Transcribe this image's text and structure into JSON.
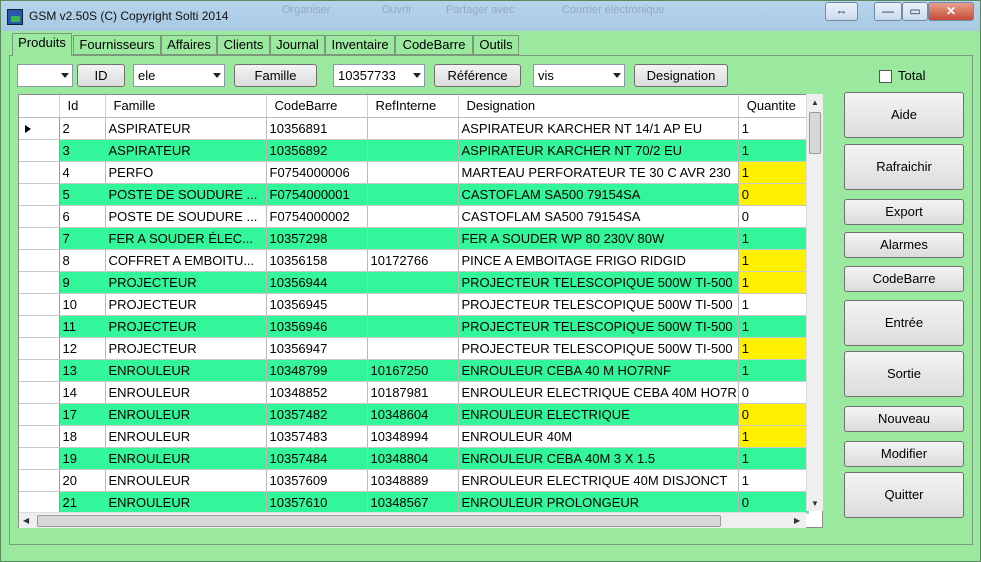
{
  "window": {
    "title": "GSM v2.50S (C) Copyright Solti 2014",
    "controls": {
      "restore": "⇔",
      "minimize": "—",
      "maximize": "▭",
      "close": "✕"
    },
    "ghost_menu": [
      "Organiser",
      "Ouvrir",
      "Partager avec",
      "Courrier électronique"
    ]
  },
  "tabs": [
    {
      "label": "Produits",
      "active": true
    },
    {
      "label": "Fournisseurs"
    },
    {
      "label": "Affaires"
    },
    {
      "label": "Clients"
    },
    {
      "label": "Journal"
    },
    {
      "label": "Inventaire"
    },
    {
      "label": "CodeBarre"
    },
    {
      "label": "Outils"
    }
  ],
  "filters": {
    "id_combo": "",
    "id_button": "ID",
    "famille_combo": "ele",
    "famille_button": "Famille",
    "reference_combo": "10357733",
    "reference_button": "Référence",
    "designation_combo": "vis",
    "designation_button": "Designation"
  },
  "total": {
    "label": "Total",
    "checked": false
  },
  "grid": {
    "columns": [
      "Id",
      "Famille",
      "CodeBarre",
      "RefInterne",
      "Designation",
      "Quantite"
    ],
    "rows": [
      {
        "id": "2",
        "famille": "ASPIRATEUR",
        "codebarre": "10356891",
        "refinterne": "",
        "designation": "ASPIRATEUR KARCHER NT 14/1 AP EU",
        "quantite": "1",
        "green": false,
        "yellow": false,
        "selected": true
      },
      {
        "id": "3",
        "famille": "ASPIRATEUR",
        "codebarre": "10356892",
        "refinterne": "",
        "designation": "ASPIRATEUR KARCHER NT 70/2 EU",
        "quantite": "1",
        "green": true,
        "yellow": false
      },
      {
        "id": "4",
        "famille": "PERFO",
        "codebarre": "F0754000006",
        "refinterne": "",
        "designation": "MARTEAU PERFORATEUR TE 30 C AVR 230",
        "quantite": "1",
        "green": false,
        "yellow": true
      },
      {
        "id": "5",
        "famille": "POSTE DE SOUDURE ...",
        "codebarre": "F0754000001",
        "refinterne": "",
        "designation": "CASTOFLAM SA500 79154SA",
        "quantite": "0",
        "green": true,
        "yellow": true
      },
      {
        "id": "6",
        "famille": "POSTE DE SOUDURE ...",
        "codebarre": "F0754000002",
        "refinterne": "",
        "designation": "CASTOFLAM SA500 79154SA",
        "quantite": "0",
        "green": false,
        "yellow": false
      },
      {
        "id": "7",
        "famille": "FER A SOUDER ÉLEC...",
        "codebarre": "10357298",
        "refinterne": "",
        "designation": "FER A SOUDER WP 80 230V 80W",
        "quantite": "1",
        "green": true,
        "yellow": false
      },
      {
        "id": "8",
        "famille": "COFFRET A EMBOITU...",
        "codebarre": "10356158",
        "refinterne": "10172766",
        "designation": "PINCE A EMBOITAGE FRIGO RIDGID",
        "quantite": "1",
        "green": false,
        "yellow": true
      },
      {
        "id": "9",
        "famille": "PROJECTEUR",
        "codebarre": "10356944",
        "refinterne": "",
        "designation": "PROJECTEUR TELESCOPIQUE 500W TI-500",
        "quantite": "1",
        "green": true,
        "yellow": true
      },
      {
        "id": "10",
        "famille": "PROJECTEUR",
        "codebarre": "10356945",
        "refinterne": "",
        "designation": "PROJECTEUR TELESCOPIQUE 500W TI-500",
        "quantite": "1",
        "green": false,
        "yellow": false
      },
      {
        "id": "11",
        "famille": "PROJECTEUR",
        "codebarre": "10356946",
        "refinterne": "",
        "designation": "PROJECTEUR TELESCOPIQUE 500W TI-500",
        "quantite": "1",
        "green": true,
        "yellow": false
      },
      {
        "id": "12",
        "famille": "PROJECTEUR",
        "codebarre": "10356947",
        "refinterne": "",
        "designation": "PROJECTEUR TELESCOPIQUE 500W TI-500",
        "quantite": "1",
        "green": false,
        "yellow": true
      },
      {
        "id": "13",
        "famille": "ENROULEUR",
        "codebarre": "10348799",
        "refinterne": "10167250",
        "designation": "ENROULEUR CEBA 40 M HO7RNF",
        "quantite": "1",
        "green": true,
        "yellow": false
      },
      {
        "id": "14",
        "famille": "ENROULEUR",
        "codebarre": "10348852",
        "refinterne": "10187981",
        "designation": "ENROULEUR ELECTRIQUE CEBA 40M HO7R",
        "quantite": "0",
        "green": false,
        "yellow": false
      },
      {
        "id": "17",
        "famille": "ENROULEUR",
        "codebarre": "10357482",
        "refinterne": "10348604",
        "designation": "ENROULEUR ELECTRIQUE",
        "quantite": "0",
        "green": true,
        "yellow": true
      },
      {
        "id": "18",
        "famille": "ENROULEUR",
        "codebarre": "10357483",
        "refinterne": "10348994",
        "designation": "ENROULEUR 40M",
        "quantite": "1",
        "green": false,
        "yellow": true
      },
      {
        "id": "19",
        "famille": "ENROULEUR",
        "codebarre": "10357484",
        "refinterne": "10348804",
        "designation": "ENROULEUR  CEBA 40M 3 X 1.5",
        "quantite": "1",
        "green": true,
        "yellow": false
      },
      {
        "id": "20",
        "famille": "ENROULEUR",
        "codebarre": "10357609",
        "refinterne": "10348889",
        "designation": "ENROULEUR ELECTRIQUE 40M  DISJONCT",
        "quantite": "1",
        "green": false,
        "yellow": false
      },
      {
        "id": "21",
        "famille": "ENROULEUR",
        "codebarre": "10357610",
        "refinterne": "10348567",
        "designation": "ENROULEUR  PROLONGEUR",
        "quantite": "0",
        "green": true,
        "yellow": false
      }
    ]
  },
  "actions": [
    "Aide",
    "Rafraichir",
    "Export",
    "Alarmes",
    "CodeBarre",
    "Entrée",
    "Sortie",
    "Nouveau",
    "Modifier",
    "Quitter"
  ],
  "colors": {
    "green_row": "#33f59a",
    "yellow_qty": "#ffef00",
    "background": "#9be89f"
  }
}
